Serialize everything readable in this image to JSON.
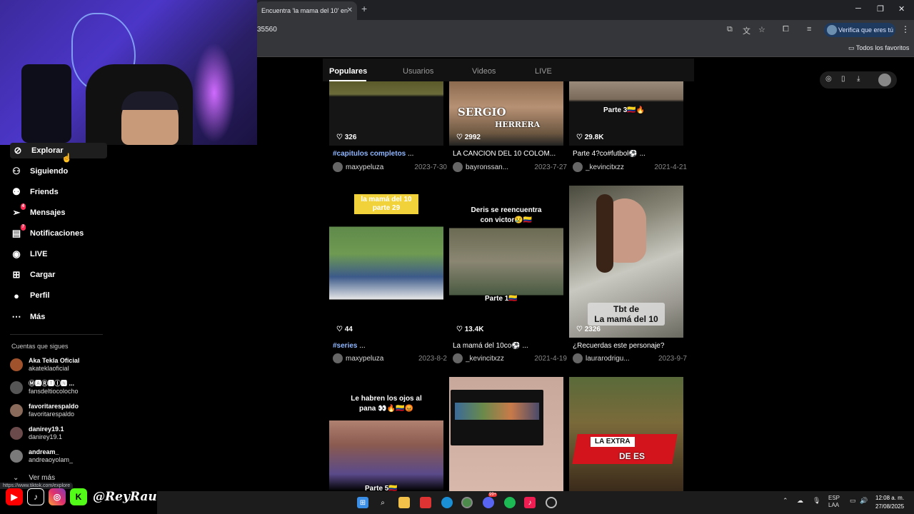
{
  "browser": {
    "tab_title": "Encuentra 'la mama del 10' en",
    "tab_close": "✕",
    "new_tab": "+",
    "url_fragment": "35560",
    "verify_label": "Verifica que eres tú",
    "bookmarks_all": "Todos los favoritos",
    "window_min": "─",
    "window_max": "❐",
    "window_close": "✕"
  },
  "nav": {
    "items": [
      {
        "label": "Explorar",
        "icon": "compass-icon"
      },
      {
        "label": "Siguiendo",
        "icon": "person-follow-icon"
      },
      {
        "label": "Friends",
        "icon": "friends-icon"
      },
      {
        "label": "Mensajes",
        "icon": "send-icon",
        "badge": "4"
      },
      {
        "label": "Notificaciones",
        "icon": "inbox-icon",
        "badge": "7"
      },
      {
        "label": "LIVE",
        "icon": "live-icon"
      },
      {
        "label": "Cargar",
        "icon": "upload-icon"
      },
      {
        "label": "Perfil",
        "icon": "profile-icon"
      },
      {
        "label": "Más",
        "icon": "more-icon"
      }
    ],
    "following_title": "Cuentas que sigues",
    "accounts": [
      {
        "name": "Aka Tekla Oficial",
        "handle": "akateklaoficial"
      },
      {
        "name": "Ⓜ🅰Ⓡ🆃Ⓘ🅽 ...",
        "handle": "fansdeltiocolocho"
      },
      {
        "name": "favoritarespaldo",
        "handle": "favoritarespaldo"
      },
      {
        "name": "danirey19.1",
        "handle": "danirey19.1"
      },
      {
        "name": "andream_",
        "handle": "andreaoyolam_"
      }
    ],
    "see_more": "Ver más",
    "status_url": "https://www.tiktok.com/explore"
  },
  "search_tabs": [
    "Populares",
    "Usuarios",
    "Videos",
    "LIVE"
  ],
  "videos": [
    {
      "likes": "326",
      "hashtag": "#capitulos completos",
      "caption": " ...",
      "user": "maxypeluza",
      "date": "2023-7-30"
    },
    {
      "likes": "2992",
      "hashtag": "",
      "caption": "LA CANCIÓN DEL 10 COLOM...",
      "user": "bayronssan...",
      "date": "2023-7-27",
      "overlay": "SERGIO",
      "overlay2": "HERRERA"
    },
    {
      "likes": "29.8K",
      "hashtag": "",
      "caption": "Parte 4?co#futbol⚽ ...",
      "user": "_kevincitxzz",
      "date": "2021-4-21",
      "overlay": "Parte 3🇨🇴🔥"
    },
    {
      "likes": "44",
      "hashtag": "#series",
      "caption": " ...",
      "user": "maxypeluza",
      "date": "2023-8-2",
      "overlay": "la mamá del 10",
      "overlay2": "parte 29"
    },
    {
      "likes": "13.4K",
      "hashtag": "",
      "caption": "La mamá del 10co⚽ ...",
      "user": "_kevincitxzz",
      "date": "2021-4-19",
      "overlay": "Deris se reencuentra",
      "overlay2": "con victor😢🇨🇴",
      "overlay3": "Parte 1🇨🇴"
    },
    {
      "likes": "2326",
      "hashtag": "",
      "caption": "¿Recuerdas este personaje?",
      "user": "laurarodrigu...",
      "date": "2023-9-7",
      "overlay": "Tbt de",
      "overlay2": "La mamá del 10"
    },
    {
      "overlay": "Le habren los ojos al",
      "overlay2": "pana 👀🔥🇨🇴😡",
      "overlay3": "Parte 5🇨🇴"
    },
    {},
    {
      "overlay": "LA EXTRA",
      "overlay2": "DE ES"
    }
  ],
  "social": {
    "handle": "@ReyRaul",
    "k_letter": "K"
  },
  "taskbar": {
    "lang": "ESP",
    "lang2": "LAA",
    "time": "12:08 a. m.",
    "date": "27/08/2025",
    "badge": "99+"
  }
}
